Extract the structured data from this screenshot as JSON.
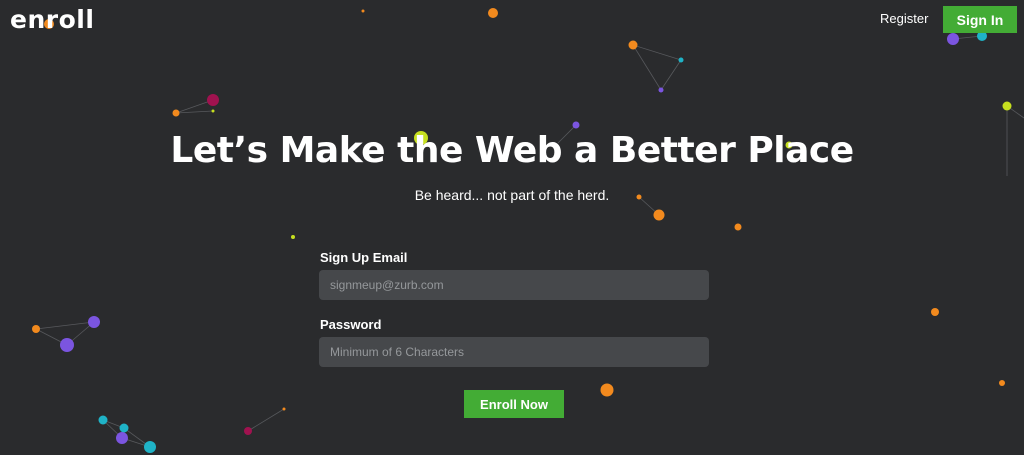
{
  "header": {
    "logo": "enroll",
    "register_link": "Register",
    "sign_in_button": "Sign In"
  },
  "hero": {
    "headline": "Let’s Make the Web a Better Place",
    "subheadline": "Be heard... not part of the herd."
  },
  "form": {
    "email_label": "Sign Up Email",
    "email_placeholder": "signmeup@zurb.com",
    "email_value": "",
    "password_label": "Password",
    "password_placeholder": "Minimum of 6 Characters",
    "password_value": "",
    "submit_label": "Enroll Now"
  },
  "colors": {
    "background": "#2a2b2d",
    "accent_green": "#43ac35",
    "input_background": "#46484b",
    "particle_orange": "#f28a1e",
    "particle_purple": "#7b55e0",
    "particle_teal": "#1fb3c7",
    "particle_lime": "#c6df1f",
    "particle_magenta": "#a0124f"
  }
}
